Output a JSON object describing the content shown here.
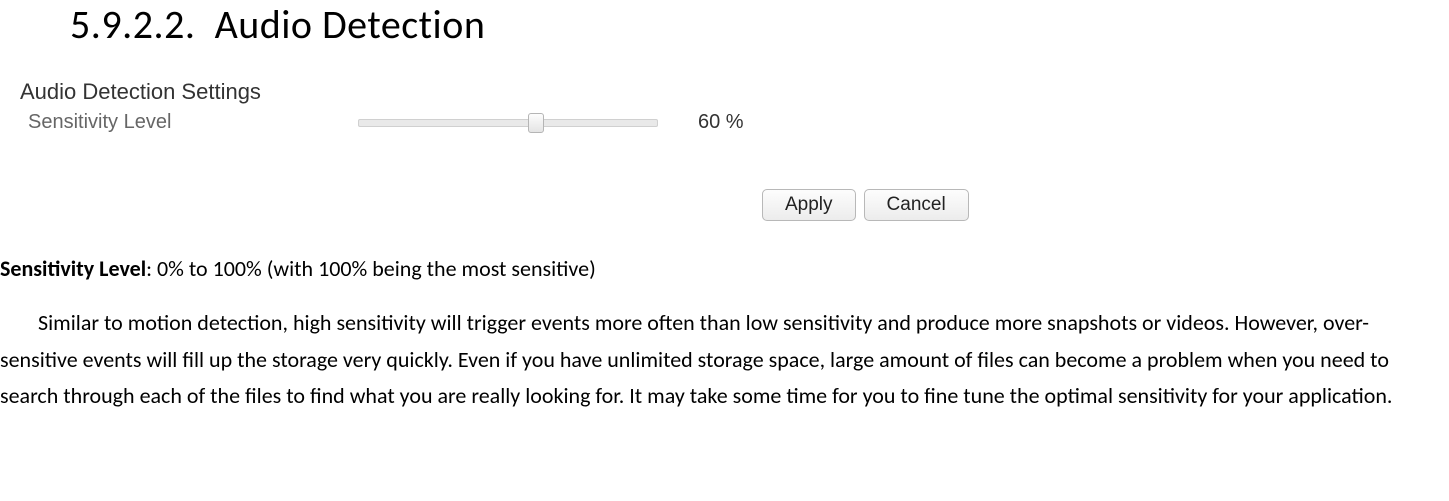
{
  "heading": {
    "number": "5.9.2.2.",
    "title": "Audio Detection"
  },
  "panel": {
    "title": "Audio Detection Settings",
    "field_label": "Sensitivity Level",
    "value_percent": 60,
    "value_display": "60 %",
    "apply_label": "Apply",
    "cancel_label": "Cancel"
  },
  "body": {
    "sens_label": "Sensitivity Level",
    "sens_desc": ": 0% to 100% (with 100% being the most sensitive)",
    "paragraph": "Similar to motion detection, high sensitivity will trigger events more often than low sensitivity and produce more snapshots or videos. However, over-sensitive events will fill up the storage very quickly. Even if you have unlimited storage space, large amount of files can become a problem when you need to search through each of the files to find what you are really looking for. It may take some time for you to fine tune the optimal sensitivity for your application."
  }
}
